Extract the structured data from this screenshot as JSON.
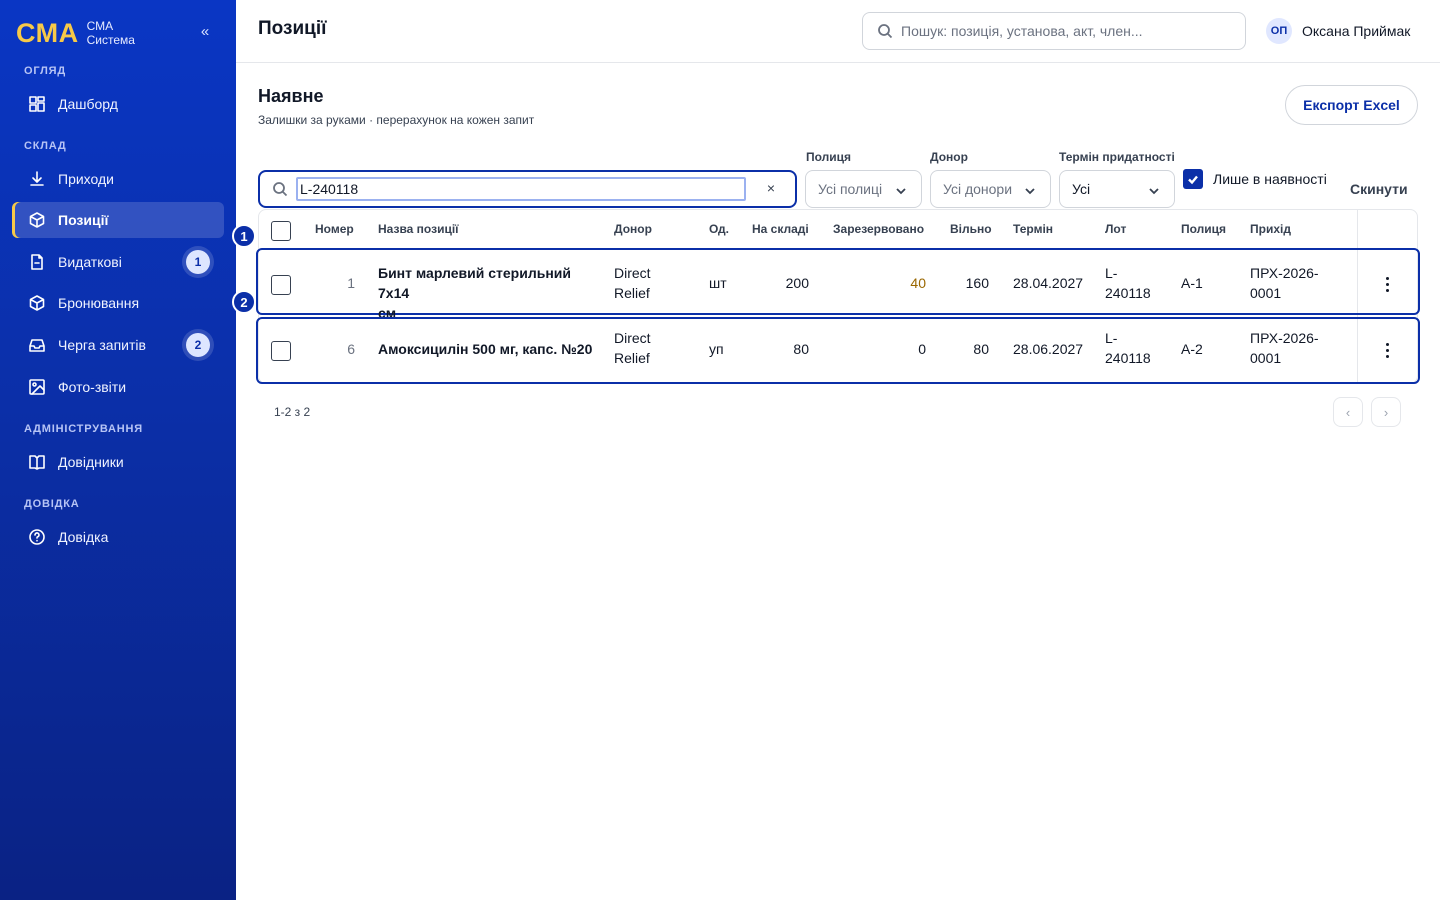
{
  "brand": {
    "logo": "СМА",
    "line1": "СМА",
    "line2": "Система",
    "collapse": "«"
  },
  "nav": {
    "sections": [
      "ОГЛЯД",
      "СКЛАД",
      "АДМІНІСТРУВАННЯ",
      "ДОВІДКА"
    ],
    "items": [
      {
        "label": "Дашборд",
        "icon": "dashboard-icon"
      },
      {
        "label": "Приходи",
        "icon": "download-icon"
      },
      {
        "label": "Позиції",
        "icon": "box-icon",
        "active": true
      },
      {
        "label": "Видаткові",
        "icon": "document-icon",
        "badge": "1"
      },
      {
        "label": "Бронювання",
        "icon": "box-icon"
      },
      {
        "label": "Черга запитів",
        "icon": "inbox-icon",
        "badge": "2"
      },
      {
        "label": "Фото-звіти",
        "icon": "image-icon"
      },
      {
        "label": "Довідники",
        "icon": "book-icon"
      },
      {
        "label": "Довідка",
        "icon": "help-circle-icon"
      }
    ]
  },
  "topbar": {
    "title": "Позиції",
    "search_placeholder": "Пошук: позиція, установа, акт, член...",
    "user_initials": "ОП",
    "user_name": "Оксана Приймак"
  },
  "main": {
    "title": "Наявне",
    "subtitle": "Залишки за руками · перерахунок на кожен запит",
    "export_label": "Експорт Excel"
  },
  "filters": {
    "search_value": "L-240118",
    "clear": "×",
    "shelf": {
      "label": "Полиця",
      "value": "Усі полиці"
    },
    "donor": {
      "label": "Донор",
      "value": "Усі донори"
    },
    "expiry": {
      "label": "Термін придатності",
      "value": "Усі"
    },
    "in_stock_label": "Лише в наявності",
    "in_stock_checked": true,
    "reset": "Скинути"
  },
  "table": {
    "columns": [
      "Номер",
      "Назва позиції",
      "Донор",
      "Од.",
      "На складі",
      "Зарезервовано",
      "Вільно",
      "Термін",
      "Лот",
      "Полиця",
      "Прихід"
    ],
    "rows": [
      {
        "marker": "2",
        "num": "1",
        "name_1": "Бинт марлевий стерильний 7x14",
        "name_2": "см",
        "donor_1": "Direct",
        "donor_2": "Relief",
        "unit": "шт",
        "stock": "200",
        "reserved": "40",
        "free": "160",
        "expiry": "28.04.2027",
        "lot_1": "L-",
        "lot_2": "240118",
        "shelf": "A-1",
        "receipt_1": "ПРХ-2026-",
        "receipt_2": "0001"
      },
      {
        "num": "6",
        "name_1": "Амоксицилін 500 мг, капс. №20",
        "donor_1": "Direct",
        "donor_2": "Relief",
        "unit": "уп",
        "stock": "80",
        "reserved": "0",
        "free": "80",
        "expiry": "28.06.2027",
        "lot_1": "L-",
        "lot_2": "240118",
        "shelf": "A-2",
        "receipt_1": "ПРХ-2026-",
        "receipt_2": "0001"
      }
    ],
    "header_marker": "1"
  },
  "pager": {
    "text": "1-2 з 2",
    "prev": "‹",
    "next": "›"
  },
  "colors": {
    "sidebar": "#0b2fa8",
    "accent": "#f7c948",
    "reserved": "#9a6700"
  }
}
